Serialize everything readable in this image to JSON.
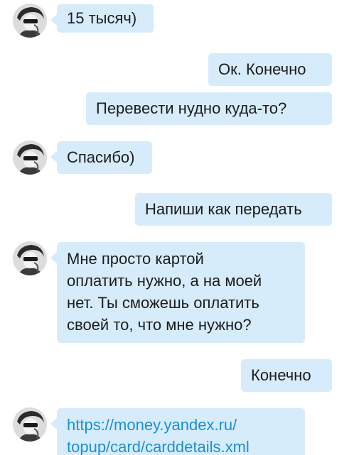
{
  "theme": {
    "bubble_color": "#d7ecfb",
    "text_color": "#1c1c1c",
    "link_color": "#1b8fd7"
  },
  "messages": [
    {
      "direction": "incoming",
      "has_avatar": true,
      "lines": [
        "15 тысяч)"
      ]
    },
    {
      "direction": "outgoing",
      "lines": [
        "Ок. Конечно"
      ]
    },
    {
      "direction": "outgoing",
      "lines": [
        "Перевести нудно куда-то?"
      ]
    },
    {
      "direction": "incoming",
      "has_avatar": true,
      "lines": [
        "Спасибо)"
      ]
    },
    {
      "direction": "outgoing",
      "lines": [
        "Напиши как передать"
      ]
    },
    {
      "direction": "incoming",
      "has_avatar": true,
      "lines": [
        "Мне просто картой",
        "оплатить нужно, а на моей",
        "нет. Ты сможешь оплатить",
        "своей то, что мне нужно?"
      ]
    },
    {
      "direction": "outgoing",
      "lines": [
        "Конечно"
      ]
    },
    {
      "direction": "incoming",
      "has_avatar": true,
      "is_link": true,
      "lines": [
        "https://money.yandex.ru/",
        "topup/card/carddetails.xml"
      ]
    }
  ]
}
